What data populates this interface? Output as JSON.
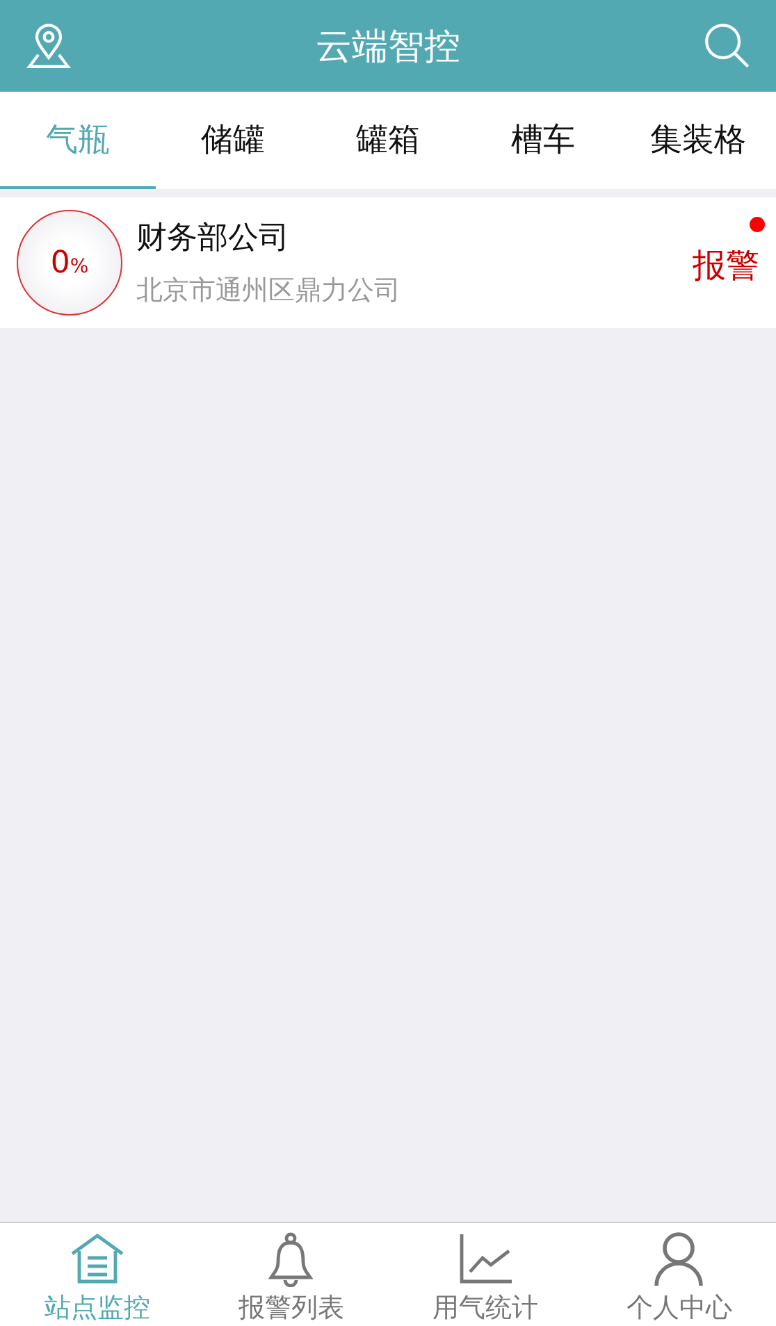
{
  "header": {
    "title": "云端智控"
  },
  "tabs": [
    {
      "label": "气瓶",
      "selected": true
    },
    {
      "label": "储罐",
      "selected": false
    },
    {
      "label": "罐箱",
      "selected": false
    },
    {
      "label": "槽车",
      "selected": false
    },
    {
      "label": "集装格",
      "selected": false
    }
  ],
  "stations": [
    {
      "percent": "0",
      "unit": "%",
      "name": "财务部公司",
      "address": "北京市通州区鼎力公司",
      "status": "报警",
      "unread": true
    }
  ],
  "bottom_nav": [
    {
      "kind": "home",
      "label": "站点监控",
      "selected": true
    },
    {
      "kind": "bell",
      "label": "报警列表",
      "selected": false
    },
    {
      "kind": "chart",
      "label": "用气统计",
      "selected": false
    },
    {
      "kind": "person",
      "label": "个人中心",
      "selected": false
    }
  ]
}
